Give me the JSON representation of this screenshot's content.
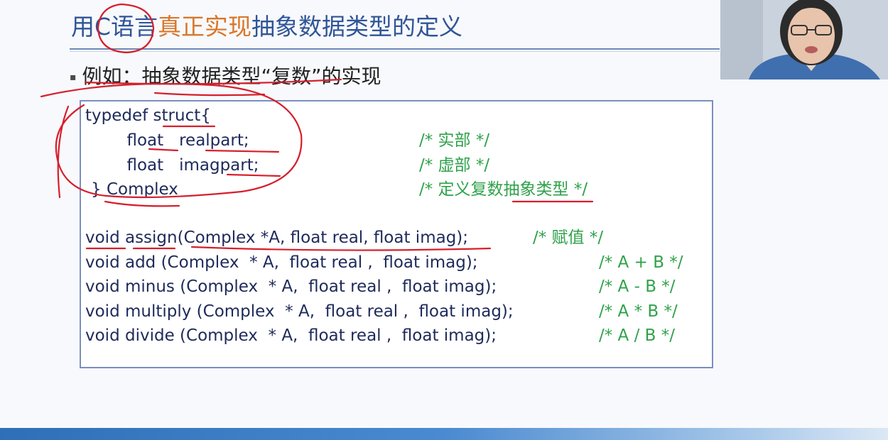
{
  "slide": {
    "title": {
      "part1": "用C语言",
      "part2": "真正实现",
      "part3": "抽象数据类型的定义"
    },
    "bullet": {
      "marker": "▪",
      "text": "例如：抽象数据类型“复数”的实现"
    },
    "code": {
      "struct_lines": [
        "typedef struct{",
        "        float   realpart;",
        "        float   imagpart;",
        "} Complex"
      ],
      "struct_comments": [
        "/* 实部 */",
        "/* 虚部 */",
        "/* 定义复数抽象类型 */"
      ],
      "func_lines": [
        "void assign(Complex *A, float real, float imag);",
        "void add (Complex  * A,  float real ,  float imag);",
        "void minus (Complex  * A,  float real ,  float imag);",
        "void multiply (Complex  * A,  float real ,  float imag);",
        "void divide (Complex  * A,  float real ,  float imag);"
      ],
      "func_comments": [
        "/* 赋值 */",
        "/* A + B */",
        "/* A - B */",
        "/* A * B */",
        "/* A / B */"
      ]
    }
  },
  "colors": {
    "title_normal": "#2f5597",
    "title_accent": "#d9772b",
    "comment": "#2fa24a",
    "annotation": "#d61f2c"
  }
}
